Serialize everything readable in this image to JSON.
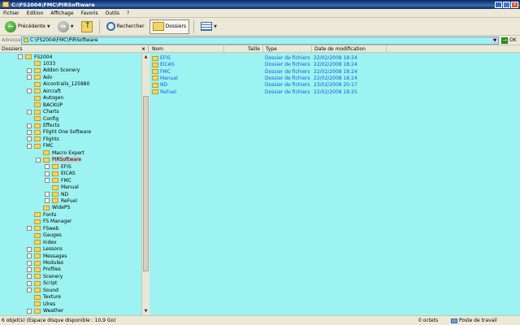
{
  "window": {
    "title": "C:\\FS2004\\FMC\\PIRSoftware"
  },
  "menu": [
    "Fichier",
    "Edition",
    "Affichage",
    "Favoris",
    "Outils",
    "?"
  ],
  "toolbar": {
    "back_label": "Précédente",
    "search_label": "Rechercher",
    "folders_label": "Dossiers"
  },
  "address": {
    "label": "Adresse",
    "value": "C:\\FS2004\\FMC\\PIRSoftware",
    "go_label": "OK"
  },
  "left_pane": {
    "title": "Dossiers"
  },
  "tree": [
    {
      "label": "FS2004",
      "level": 0,
      "exp": "-"
    },
    {
      "label": "1033",
      "level": 1,
      "exp": ""
    },
    {
      "label": "Addon Scenery",
      "level": 1,
      "exp": "+"
    },
    {
      "label": "Adv",
      "level": 1,
      "exp": "+"
    },
    {
      "label": "Aicontrails_125880",
      "level": 1,
      "exp": ""
    },
    {
      "label": "Aircraft",
      "level": 1,
      "exp": "+"
    },
    {
      "label": "Autogen",
      "level": 1,
      "exp": ""
    },
    {
      "label": "BACKUP",
      "level": 1,
      "exp": ""
    },
    {
      "label": "Charts",
      "level": 1,
      "exp": "+"
    },
    {
      "label": "Config",
      "level": 1,
      "exp": ""
    },
    {
      "label": "Effects",
      "level": 1,
      "exp": "+"
    },
    {
      "label": "Flight One Software",
      "level": 1,
      "exp": "+"
    },
    {
      "label": "Flights",
      "level": 1,
      "exp": "+"
    },
    {
      "label": "FMC",
      "level": 1,
      "exp": "-"
    },
    {
      "label": "Macro Expert",
      "level": 2,
      "exp": ""
    },
    {
      "label": "PIRSoftware",
      "level": 2,
      "exp": "-",
      "selected": true
    },
    {
      "label": "EFIS",
      "level": 3,
      "exp": "+"
    },
    {
      "label": "EICAS",
      "level": 3,
      "exp": "+"
    },
    {
      "label": "FMC",
      "level": 3,
      "exp": "+"
    },
    {
      "label": "Manual",
      "level": 3,
      "exp": ""
    },
    {
      "label": "ND",
      "level": 3,
      "exp": "+"
    },
    {
      "label": "ReFuel",
      "level": 3,
      "exp": "+"
    },
    {
      "label": "WidePS",
      "level": 2,
      "exp": ""
    },
    {
      "label": "Fonts",
      "level": 1,
      "exp": ""
    },
    {
      "label": "FS Manager",
      "level": 1,
      "exp": ""
    },
    {
      "label": "FSweb",
      "level": 1,
      "exp": "+"
    },
    {
      "label": "Gauges",
      "level": 1,
      "exp": ""
    },
    {
      "label": "Index",
      "level": 1,
      "exp": ""
    },
    {
      "label": "Lessons",
      "level": 1,
      "exp": "+"
    },
    {
      "label": "Messages",
      "level": 1,
      "exp": "+"
    },
    {
      "label": "Modules",
      "level": 1,
      "exp": "+"
    },
    {
      "label": "Profiles",
      "level": 1,
      "exp": "+"
    },
    {
      "label": "Scenery",
      "level": 1,
      "exp": "+"
    },
    {
      "label": "Script",
      "level": 1,
      "exp": "+"
    },
    {
      "label": "Sound",
      "level": 1,
      "exp": "+"
    },
    {
      "label": "Texture",
      "level": 1,
      "exp": ""
    },
    {
      "label": "Ulres",
      "level": 1,
      "exp": ""
    },
    {
      "label": "Weather",
      "level": 1,
      "exp": "+"
    }
  ],
  "columns": {
    "name": "Nom",
    "size": "Taille",
    "type": "Type",
    "date": "Date de modification"
  },
  "files": [
    {
      "name": "EFIS",
      "type": "Dossier de fichiers",
      "date": "22/02/2008 18:24"
    },
    {
      "name": "EICAS",
      "type": "Dossier de fichiers",
      "date": "22/02/2008 18:24"
    },
    {
      "name": "FMC",
      "type": "Dossier de fichiers",
      "date": "22/02/2008 18:24"
    },
    {
      "name": "Manual",
      "type": "Dossier de fichiers",
      "date": "22/02/2008 18:24"
    },
    {
      "name": "ND",
      "type": "Dossier de fichiers",
      "date": "23/02/2008 20:17"
    },
    {
      "name": "ReFuel",
      "type": "Dossier de fichiers",
      "date": "22/02/2008 18:25"
    }
  ],
  "status": {
    "left": "6 objet(s) (Espace disque disponible : 10,9 Go)",
    "size": "0 octets",
    "zone": "Poste de travail"
  }
}
